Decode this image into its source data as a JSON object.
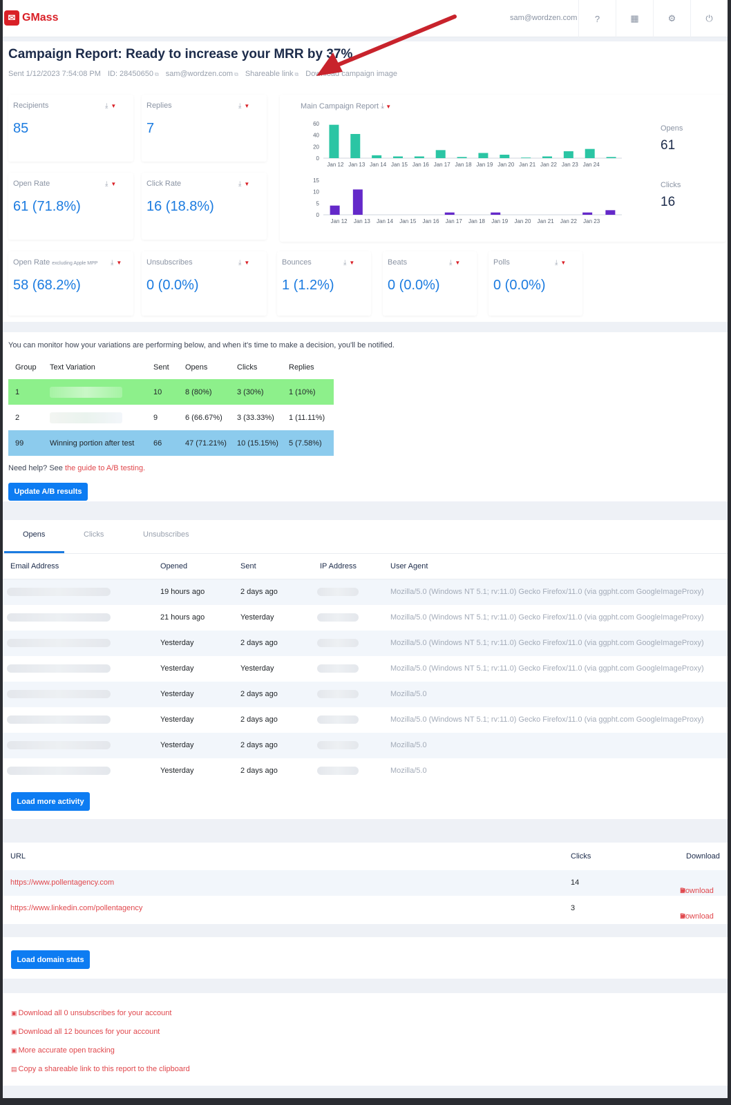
{
  "app": {
    "name": "GMass",
    "user_email": "sam@wordzen.com"
  },
  "header_icons": [
    "help-icon",
    "apps-grid-icon",
    "settings-icon",
    "power-icon"
  ],
  "report": {
    "title": "Campaign Report: Ready to increase your MRR by 37%",
    "sent": "Sent 1/12/2023 7:54:08 PM",
    "id": "ID: 28450650",
    "email": "sam@wordzen.com",
    "shareable_link": "Shareable link",
    "download_image": "Download campaign image"
  },
  "stats": [
    {
      "label": "Recipients",
      "value": "85"
    },
    {
      "label": "Replies",
      "value": "7"
    },
    {
      "label": "Open Rate",
      "value": "61 (71.8%)"
    },
    {
      "label": "Click Rate",
      "value": "16 (18.8%)"
    },
    {
      "label": "Open Rate",
      "label_small": "excluding Apple MPP",
      "value": "58 (68.2%)"
    },
    {
      "label": "Unsubscribes",
      "value": "0 (0.0%)"
    },
    {
      "label": "Bounces",
      "value": "1 (1.2%)"
    },
    {
      "label": "Beats",
      "value": "0 (0.0%)"
    },
    {
      "label": "Polls",
      "value": "0 (0.0%)"
    }
  ],
  "main_report": {
    "label": "Main Campaign Report",
    "opens_label": "Opens",
    "opens_value": "61",
    "clicks_label": "Clicks",
    "clicks_value": "16"
  },
  "chart_data": [
    {
      "type": "bar",
      "categories": [
        "Jan 12",
        "Jan 13",
        "Jan 14",
        "Jan 15",
        "Jan 16",
        "Jan 17",
        "Jan 18",
        "Jan 19",
        "Jan 20",
        "Jan 21",
        "Jan 22",
        "Jan 23",
        "Jan 24"
      ],
      "series": [
        {
          "name": "Opens",
          "values": [
            58,
            42,
            5,
            3,
            3,
            14,
            2,
            9,
            6,
            1,
            3,
            12,
            16,
            2
          ]
        }
      ],
      "ylim": [
        0,
        60
      ],
      "yticks": [
        0,
        20,
        40,
        60
      ],
      "color": "#2bc5a4"
    },
    {
      "type": "bar",
      "categories": [
        "Jan 12",
        "Jan 13",
        "Jan 14",
        "Jan 15",
        "Jan 16",
        "Jan 17",
        "Jan 18",
        "Jan 19",
        "Jan 20",
        "Jan 21",
        "Jan 22",
        "Jan 23"
      ],
      "series": [
        {
          "name": "Clicks",
          "values": [
            4,
            11,
            0,
            0,
            0,
            1,
            0,
            1,
            0,
            0,
            0,
            1,
            2
          ]
        }
      ],
      "ylim": [
        0,
        15
      ],
      "yticks": [
        0,
        5,
        10,
        15
      ],
      "color": "#6429c9"
    }
  ],
  "ab": {
    "intro": "You can monitor how your variations are performing below, and when it's time to make a decision, you'll be notified.",
    "headers": [
      "Group",
      "Text Variation",
      "Sent",
      "Opens",
      "Clicks",
      "Replies"
    ],
    "rows": [
      {
        "group": "1",
        "variation": "",
        "sent": "10",
        "opens": "8 (80%)",
        "clicks": "3 (30%)",
        "replies": "1 (10%)"
      },
      {
        "group": "2",
        "variation": "",
        "sent": "9",
        "opens": "6 (66.67%)",
        "clicks": "3 (33.33%)",
        "replies": "1 (11.11%)"
      },
      {
        "group": "99",
        "variation": "Winning portion after test",
        "sent": "66",
        "opens": "47 (71.21%)",
        "clicks": "10 (15.15%)",
        "replies": "5 (7.58%)"
      }
    ],
    "help_prefix": "Need help? See ",
    "help_link": "the guide to A/B testing.",
    "update_button": "Update A/B results",
    "row_colors": [
      "#8df08b",
      "#ffffff",
      "#8ccbed"
    ]
  },
  "activity": {
    "tabs": [
      "Opens",
      "Clicks",
      "Unsubscribes"
    ],
    "headers": [
      "Email Address",
      "Opened",
      "Sent",
      "IP Address",
      "User Agent"
    ],
    "rows": [
      {
        "opened": "19 hours ago",
        "sent": "2 days ago",
        "ua": "Mozilla/5.0 (Windows NT 5.1; rv:11.0) Gecko Firefox/11.0 (via ggpht.com GoogleImageProxy)"
      },
      {
        "opened": "21 hours ago",
        "sent": "Yesterday",
        "ua": "Mozilla/5.0 (Windows NT 5.1; rv:11.0) Gecko Firefox/11.0 (via ggpht.com GoogleImageProxy)"
      },
      {
        "opened": "Yesterday",
        "sent": "2 days ago",
        "ua": "Mozilla/5.0 (Windows NT 5.1; rv:11.0) Gecko Firefox/11.0 (via ggpht.com GoogleImageProxy)"
      },
      {
        "opened": "Yesterday",
        "sent": "Yesterday",
        "ua": "Mozilla/5.0 (Windows NT 5.1; rv:11.0) Gecko Firefox/11.0 (via ggpht.com GoogleImageProxy)"
      },
      {
        "opened": "Yesterday",
        "sent": "2 days ago",
        "ua": "Mozilla/5.0"
      },
      {
        "opened": "Yesterday",
        "sent": "2 days ago",
        "ua": "Mozilla/5.0 (Windows NT 5.1; rv:11.0) Gecko Firefox/11.0 (via ggpht.com GoogleImageProxy)"
      },
      {
        "opened": "Yesterday",
        "sent": "2 days ago",
        "ua": "Mozilla/5.0"
      },
      {
        "opened": "Yesterday",
        "sent": "2 days ago",
        "ua": "Mozilla/5.0"
      }
    ],
    "load_more": "Load more activity"
  },
  "urls": {
    "headers": [
      "URL",
      "Clicks",
      "Download"
    ],
    "rows": [
      {
        "url": "https://www.pollentagency.com",
        "clicks": "14",
        "download": "Download"
      },
      {
        "url": "https://www.linkedin.com/pollentagency",
        "clicks": "3",
        "download": "Download"
      }
    ]
  },
  "domain_button": "Load domain stats",
  "bottom_links": [
    "Download all 0 unsubscribes for your account",
    "Download all 12 bounces for your account",
    "More accurate open tracking",
    "Copy a shareable link to this report to the clipboard"
  ],
  "colors": {
    "accent": "#1b7be0",
    "brand": "#d92027",
    "link": "#e0474c",
    "button": "#0d7cf2"
  }
}
